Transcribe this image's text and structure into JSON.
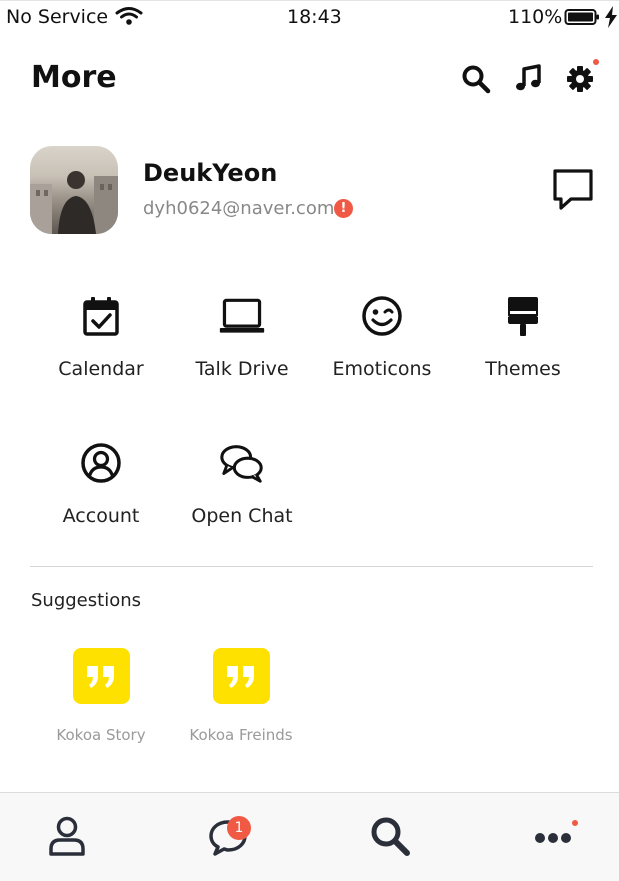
{
  "status_bar": {
    "carrier": "No Service",
    "time": "18:43",
    "battery": "110%"
  },
  "header": {
    "title": "More",
    "icons": [
      "search-icon",
      "music-icon",
      "gear-icon"
    ],
    "settings_notification_color": "#f05a45"
  },
  "profile": {
    "name": "DeukYeon",
    "email": "dyh0624@naver.com",
    "warning_glyph": "!",
    "chat_icon": "speech-bubble-icon"
  },
  "menu": [
    {
      "label": "Calendar",
      "icon": "calendar-icon"
    },
    {
      "label": "Talk Drive",
      "icon": "laptop-icon"
    },
    {
      "label": "Emoticons",
      "icon": "wink-face-icon"
    },
    {
      "label": "Themes",
      "icon": "paint-brush-icon"
    },
    {
      "label": "Account",
      "icon": "user-circle-icon"
    },
    {
      "label": "Open Chat",
      "icon": "chat-bubbles-icon"
    }
  ],
  "suggestions": {
    "title": "Suggestions",
    "items": [
      {
        "label": "Kokoa Story",
        "icon": "quote-icon"
      },
      {
        "label": "Kokoa Freinds",
        "icon": "quote-icon"
      }
    ],
    "accent_color": "#ffe100"
  },
  "tab_bar": {
    "tabs": [
      {
        "icon": "person-icon"
      },
      {
        "icon": "chat-bubble-icon",
        "badge": "1"
      },
      {
        "icon": "search-icon"
      },
      {
        "icon": "more-dots-icon"
      }
    ]
  }
}
